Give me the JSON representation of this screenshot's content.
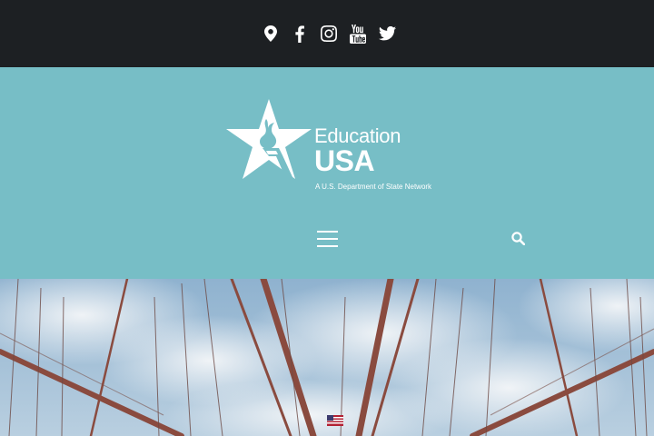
{
  "topbar": {
    "social_icons": [
      "map-marker-icon",
      "facebook-icon",
      "instagram-icon",
      "youtube-icon",
      "twitter-icon"
    ]
  },
  "logo": {
    "line1": "Education",
    "line2": "USA",
    "tagline": "A U.S. Department of State Network"
  },
  "nav": {
    "menu_icon": "hamburger-menu-icon",
    "search_icon": "search-icon"
  },
  "hero": {
    "image": "photo of Brooklyn Bridge cables against a cloudy sky with a small American flag"
  },
  "colors": {
    "topbar_bg": "#1d2023",
    "header_bg": "#77bec6",
    "icon": "#ffffff"
  }
}
